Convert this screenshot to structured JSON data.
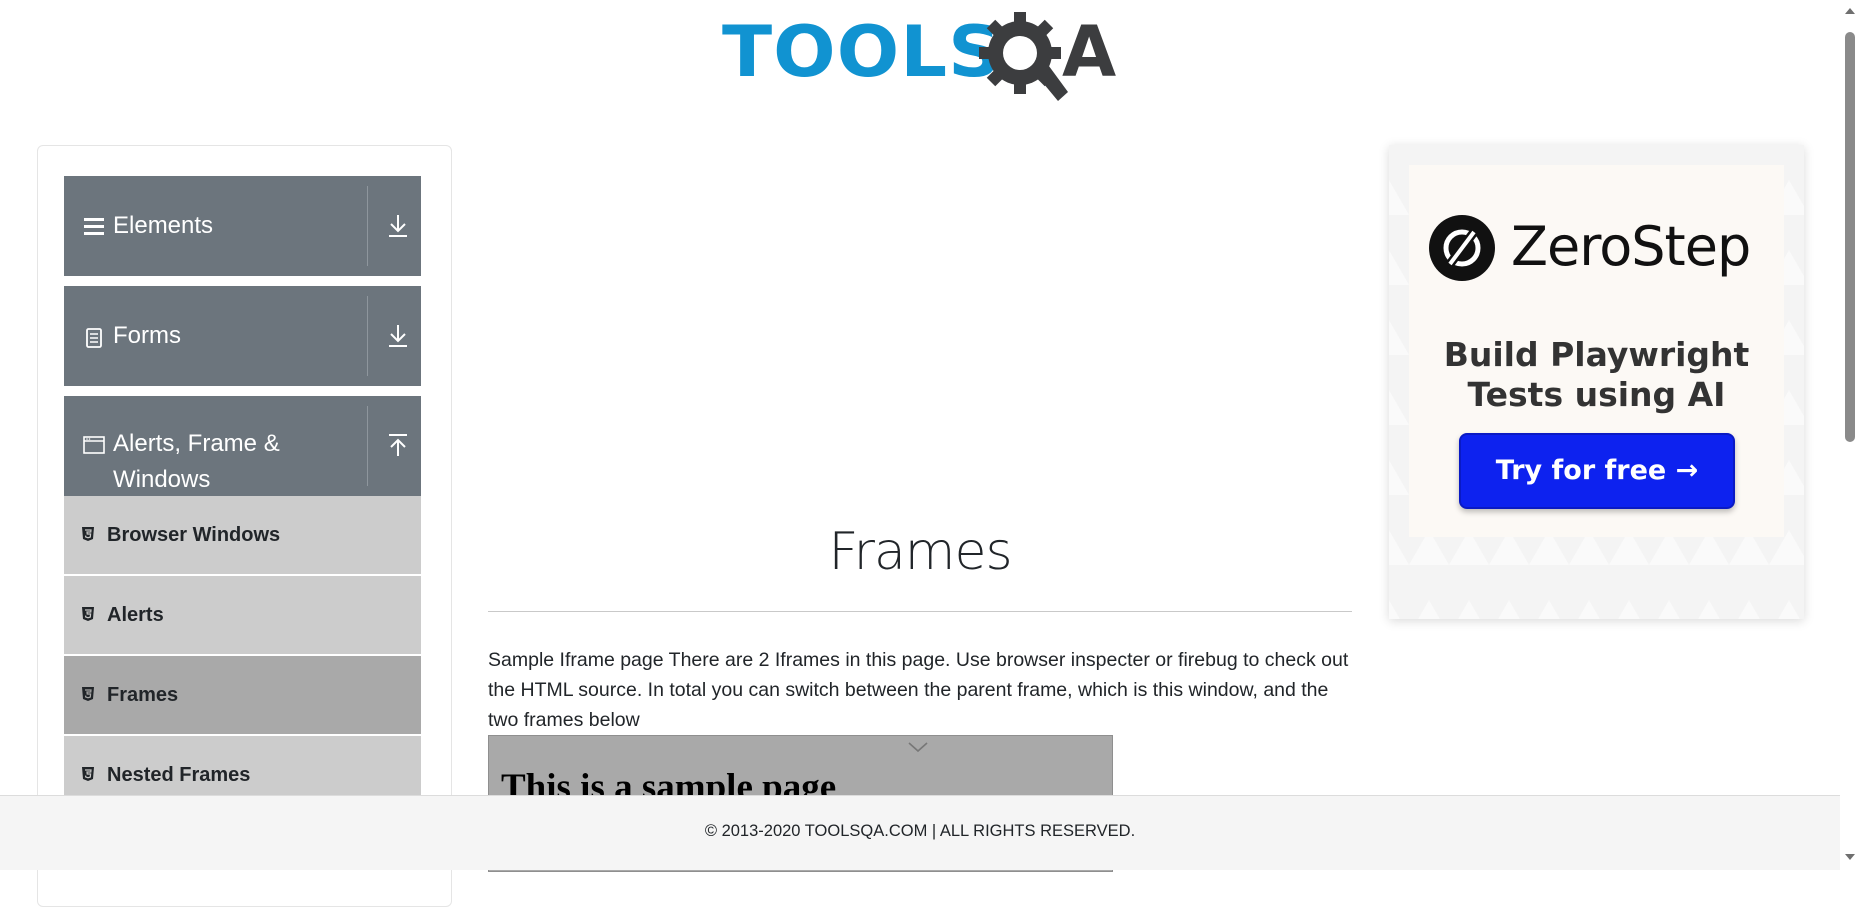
{
  "header": {
    "logo_text_tools": "TOOLS",
    "logo_text_a": "A",
    "logo_alt": "TOOLSQA"
  },
  "sidebar": {
    "groups": [
      {
        "label": "Elements",
        "icon": "hamburger-icon",
        "toggle_icon": "download-arrow-icon"
      },
      {
        "label": "Forms",
        "icon": "document-icon",
        "toggle_icon": "download-arrow-icon"
      },
      {
        "label": "Alerts, Frame &",
        "label_line2": "Windows",
        "icon": "window-icon",
        "toggle_icon": "upload-arrow-icon"
      }
    ],
    "items": [
      {
        "label": "Browser Windows",
        "icon": "html5-icon"
      },
      {
        "label": "Alerts",
        "icon": "html5-icon"
      },
      {
        "label": "Frames",
        "icon": "html5-icon",
        "active": true
      },
      {
        "label": "Nested Frames",
        "icon": "html5-icon"
      }
    ]
  },
  "main": {
    "title": "Frames",
    "intro": "Sample Iframe page There are 2 Iframes in this page. Use browser inspecter or firebug to check out the HTML source. In total you can switch between the parent frame, which is this window, and the two frames below",
    "frame1_heading": "This is a sample page"
  },
  "ad": {
    "brand": "ZeroStep",
    "headline_line1": "Build Playwright",
    "headline_line2": "Tests using AI",
    "cta": "Try for free →"
  },
  "footer": {
    "text": "© 2013-2020 TOOLSQA.COM | ALL RIGHTS RESERVED."
  },
  "colors": {
    "accent_blue": "#1193d1",
    "sidebar_header": "#6c757d",
    "sidebar_item": "#cccccc",
    "sidebar_item_active": "#a9a9a9",
    "ad_cta": "#0d22ef"
  }
}
